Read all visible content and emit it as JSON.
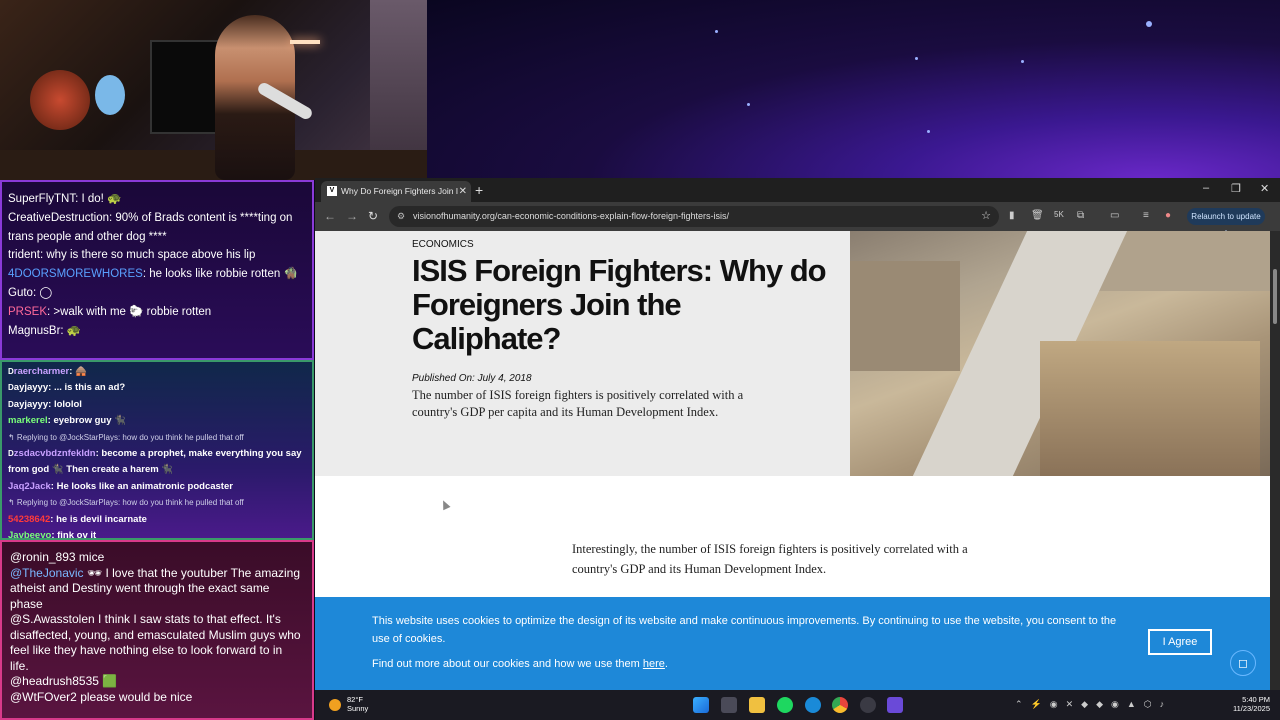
{
  "webcam": {
    "label": "streamer webcam"
  },
  "chat_twitch": [
    {
      "user": "SuperFlyTNT",
      "color": "#ffffff",
      "text": "I do! 🐢"
    },
    {
      "user": "CreativeDestruction",
      "color": "#ffffff",
      "text": "90% of Brads content is ****ting on trans people and other dog ****"
    },
    {
      "user": "trident",
      "color": "#ffffff",
      "text": "why is there so much space above his lip"
    },
    {
      "user": "4DOORSMOREWHORES",
      "color": "#5aa0ff",
      "text": "he looks like robbie rotten 🧌"
    },
    {
      "user": "Guto",
      "color": "#ffffff",
      "text": "◯"
    },
    {
      "user": "PRSEK",
      "color": "#ff6a9a",
      "text": ">walk with me 🐑 robbie rotten"
    },
    {
      "user": "MagnusBr",
      "color": "#ffffff",
      "text": "🐢"
    }
  ],
  "chat_mid": [
    {
      "user": "raercharmer",
      "color": "#c8a0ff",
      "text": "🛖",
      "prefix": "D"
    },
    {
      "user": "ayjayyy",
      "color": "#ffffff",
      "text": "... is this an ad?",
      "prefix": "D"
    },
    {
      "user": "ayjayyy",
      "color": "#ffffff",
      "text": "lololol",
      "prefix": "D"
    },
    {
      "user": "markerel",
      "color": "#7aff7a",
      "text": "eyebrow guy 🐈‍⬛",
      "prefix": ""
    },
    {
      "reply": "↰ Replying to @JockStarPlays: how do you think he pulled that off"
    },
    {
      "user": "zsdacvbdznfekldn",
      "color": "#c8a0ff",
      "text": "become a prophet, make everything you say from god 🐈‍⬛ Then create a harem 🐈‍⬛",
      "prefix": "D"
    },
    {
      "user": "Jaq2Jack",
      "color": "#c8a0ff",
      "text": "He looks like an animatronic podcaster",
      "prefix": ""
    },
    {
      "reply": "↰ Replying to @JockStarPlays: how do you think he pulled that off"
    },
    {
      "user": "54238642",
      "color": "#ff3a3a",
      "text": "he is devil incarnate",
      "prefix": ""
    },
    {
      "user": "Javbeeyo",
      "color": "#7aff7a",
      "text": "fink ov it",
      "prefix": ""
    }
  ],
  "chat_youtube": [
    {
      "user": "@ronin_893",
      "color": "#ffffff",
      "text": "mice"
    },
    {
      "user": "@TheJonavic",
      "color": "#7ab8ff",
      "text": "🕶 I love that the youtuber The amazing atheist and Destiny went through the exact same phase"
    },
    {
      "user": "@S.Awasstolen",
      "color": "#ffffff",
      "text": "I think I saw stats to that effect. It's disaffected, young, and emasculated Muslim guys who feel like they have nothing else to look forward to in life."
    },
    {
      "user": "@headrush8535",
      "color": "#ffffff",
      "text": "🟩"
    },
    {
      "user": "@WtFOver2",
      "color": "#ffffff",
      "text": "please would be nice"
    }
  ],
  "browser": {
    "tab_title": "Why Do Foreign Fighters Join I",
    "favicon": "V",
    "new_tab": "+",
    "url": "visionofhumanity.org/can-economic-conditions-explain-flow-foreign-fighters-isis/",
    "relaunch_label": "Relaunch to update",
    "win_min": "–",
    "win_max": "❐",
    "win_close": "✕"
  },
  "article": {
    "category": "ECONOMICS",
    "headline": "ISIS Foreign Fighters: Why do Foreigners Join the Caliphate?",
    "published": "Published On: July 4, 2018",
    "summary": "The number of ISIS foreign fighters is positively correlated with a country's GDP per capita and its Human Development Index.",
    "body": "Interestingly, the number of ISIS foreign fighters is positively correlated with a country's GDP and its Human Development Index."
  },
  "cookie": {
    "text": "This website uses cookies to optimize the design of its website and make continuous improvements. By continuing to use the website, you consent to the use of cookies.",
    "link_prefix": "Find out more about our cookies and how we use them ",
    "link_text": "here",
    "link_suffix": ".",
    "agree_label": "I Agree"
  },
  "taskbar": {
    "temperature": "82°F",
    "condition": "Sunny",
    "time": "5:40 PM",
    "date": "11/23/2025"
  },
  "colors": {
    "cookie_bg": "#1e88d8",
    "browser_dark": "#1f1f1f"
  }
}
